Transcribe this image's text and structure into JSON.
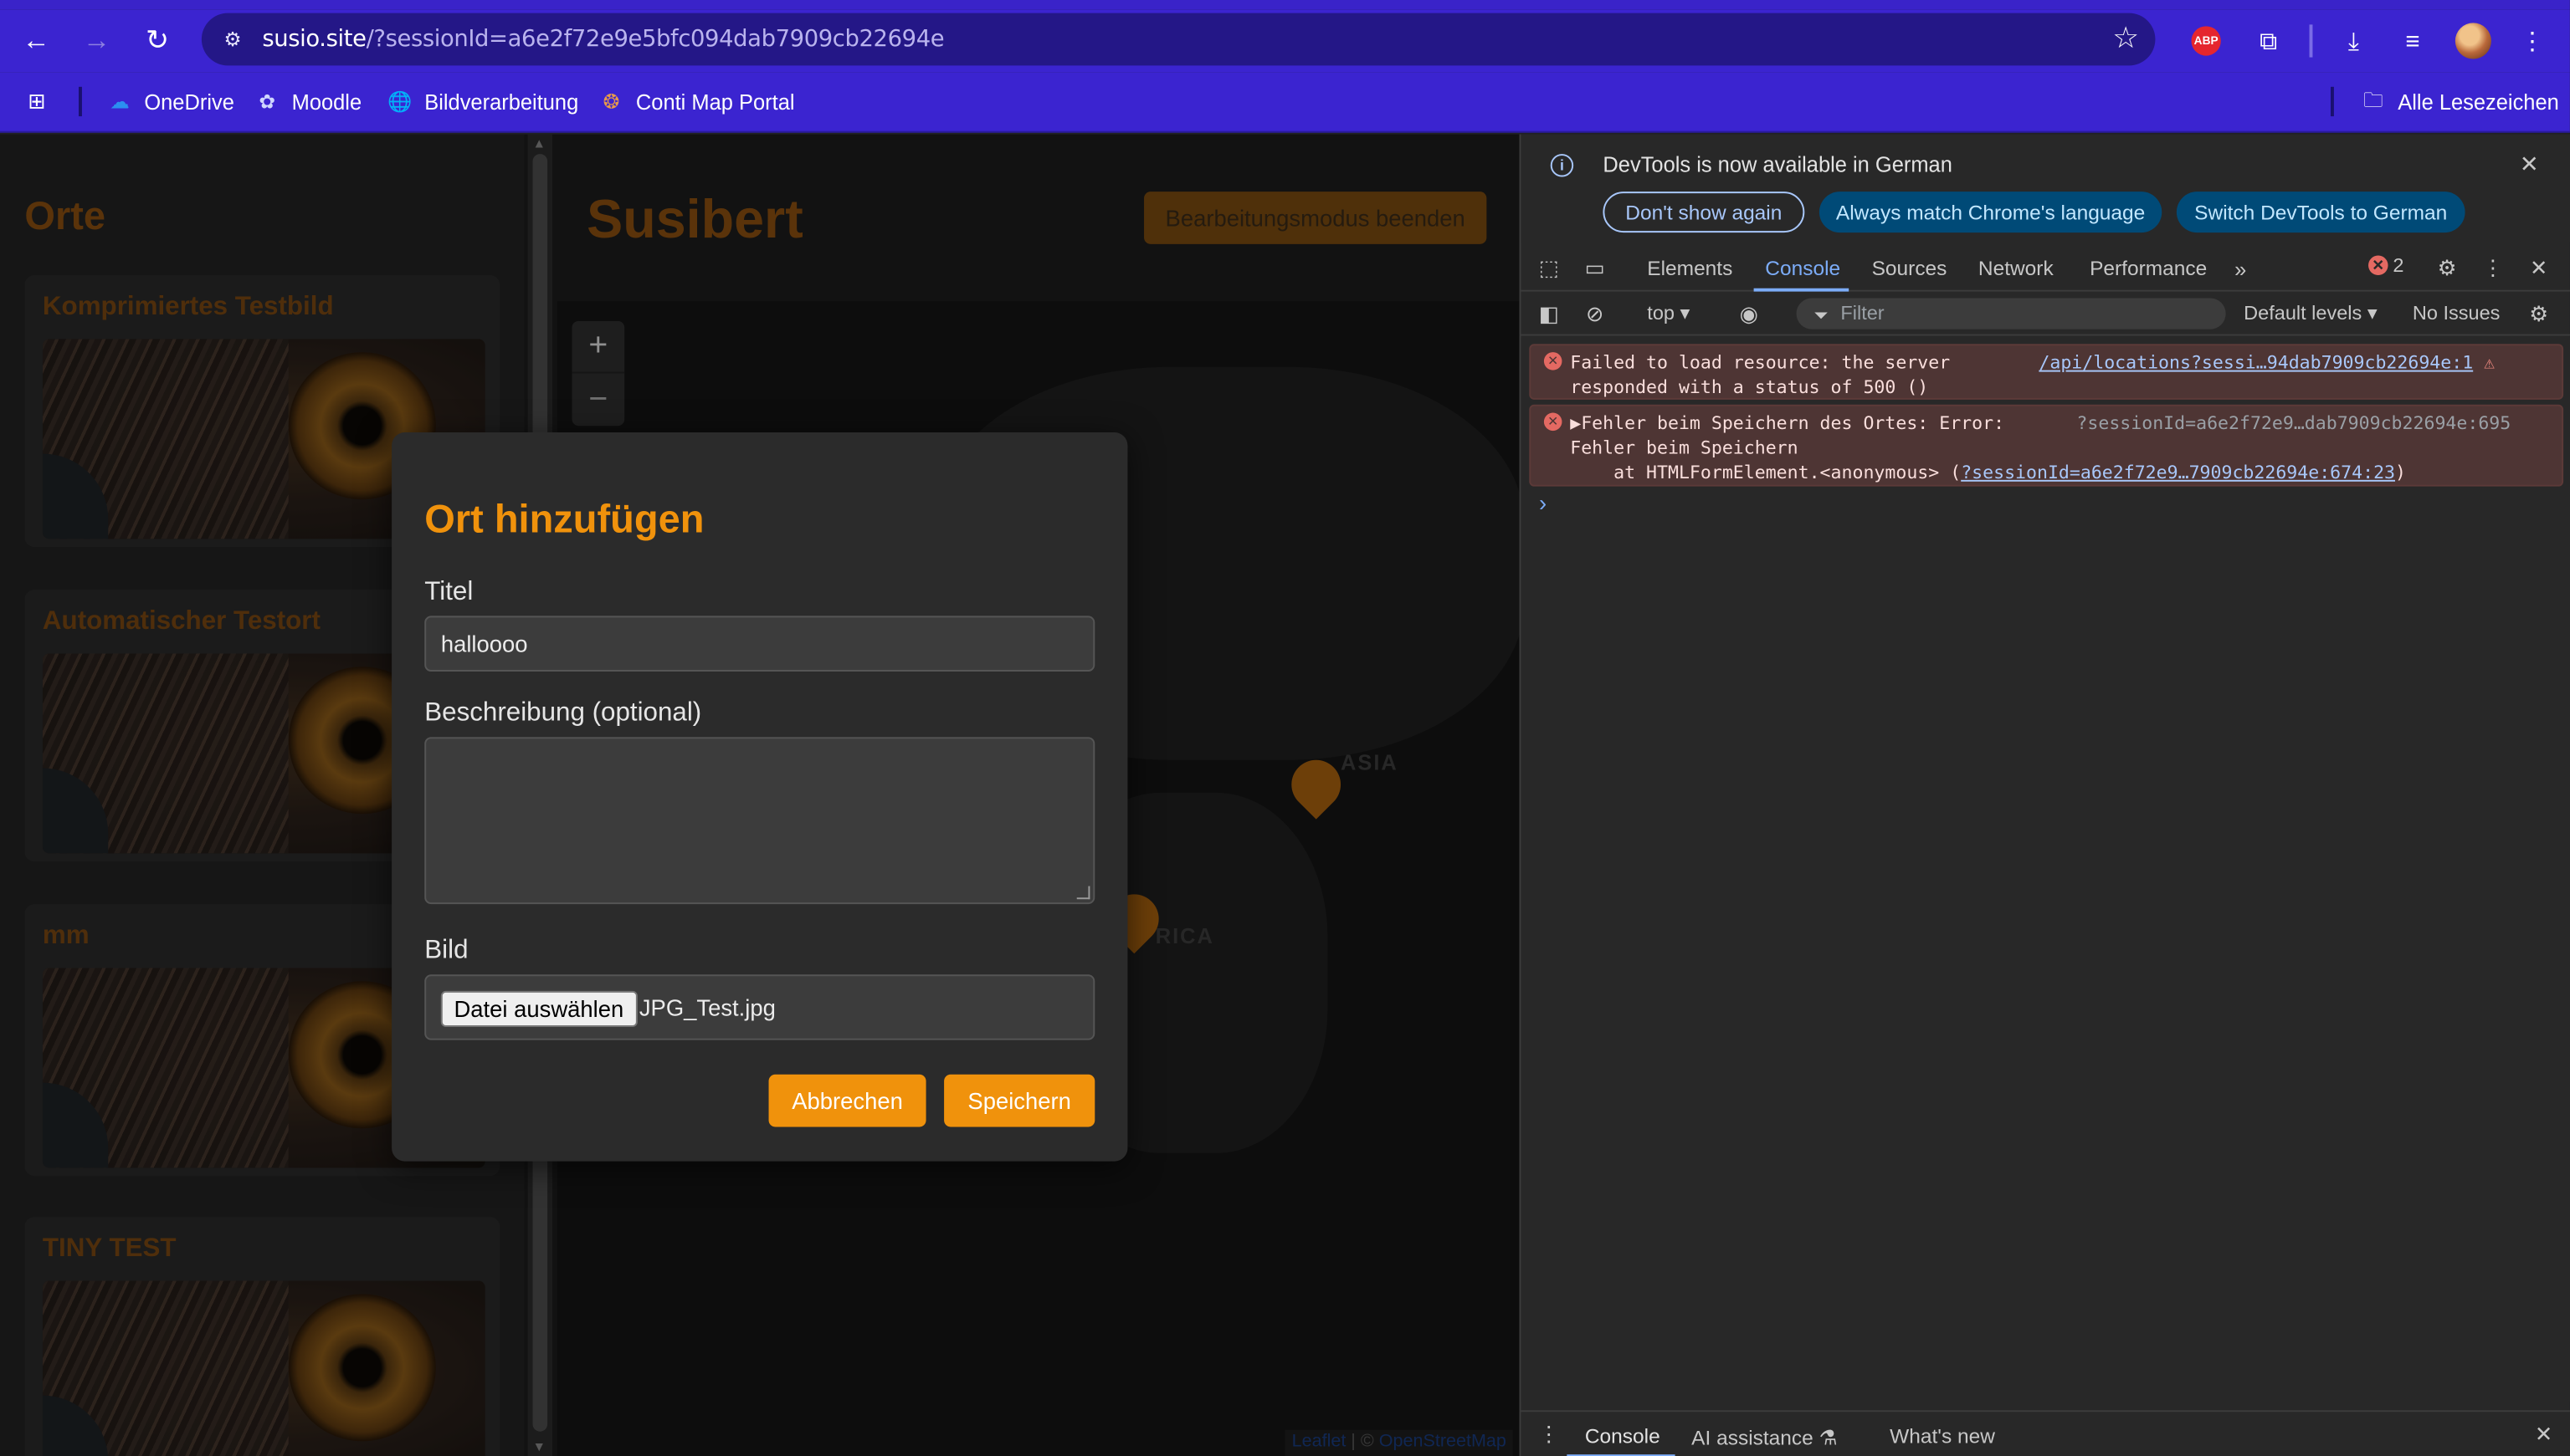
{
  "browser": {
    "url_host": "susio.site",
    "url_path": "/?sessionId=a6e2f72e9e5bfc094dab7909cb22694e",
    "abp_label": "ABP",
    "bookmarks": [
      {
        "label": "OneDrive",
        "icon": "onedrive-icon"
      },
      {
        "label": "Moodle",
        "icon": "moodle-icon"
      },
      {
        "label": "Bildverarbeitung",
        "icon": "globe-icon"
      },
      {
        "label": "Conti Map Portal",
        "icon": "conti-icon"
      }
    ],
    "all_bookmarks_label": "Alle Lesezeichen"
  },
  "sidebar": {
    "title": "Orte",
    "cards": [
      {
        "title": "Komprimiertes Testbild"
      },
      {
        "title": "Automatischer Testort"
      },
      {
        "title": "mm"
      },
      {
        "title": "TINY TEST"
      }
    ]
  },
  "main": {
    "title": "Susibert",
    "edit_button": "Bearbeitungsmodus beenden",
    "map": {
      "zoom_in": "+",
      "zoom_out": "−",
      "labels": [
        "ASIA",
        "RICA"
      ],
      "attribution_leaflet": "Leaflet",
      "attribution_sep": " | © ",
      "attribution_osm": "OpenStreetMap"
    }
  },
  "modal": {
    "title": "Ort hinzufügen",
    "title_label": "Titel",
    "title_value": "halloooo",
    "description_label": "Beschreibung (optional)",
    "description_value": "",
    "image_label": "Bild",
    "file_button": "Datei auswählen",
    "file_name": "JPG_Test.jpg",
    "cancel_button": "Abbrechen",
    "save_button": "Speichern"
  },
  "devtools": {
    "banner_message": "DevTools is now available in German",
    "banner_buttons": [
      "Don't show again",
      "Always match Chrome's language",
      "Switch DevTools to German"
    ],
    "tabs": [
      "Elements",
      "Console",
      "Sources",
      "Network",
      "Performance"
    ],
    "active_tab": "Console",
    "error_count": "2",
    "context": "top",
    "filter_placeholder": "Filter",
    "levels": "Default levels",
    "issues": "No Issues",
    "messages": [
      {
        "text": "Failed to load resource: the server\nresponded with a status of 500 ()",
        "source": "/api/locations?sessi…94dab7909cb22694e:1"
      },
      {
        "text": "▶Fehler beim Speichern des Ortes: Error:\nFehler beim Speichern\n    at HTMLFormElement.<anonymous> (",
        "source": "?sessionId=a6e2f72e9…dab7909cb22694e:695",
        "inline_link": "?sessionId=a6e2f72e9…7909cb22694e:674:23",
        "close_paren": ")"
      }
    ],
    "drawer_tabs": [
      "Console",
      "AI assistance",
      "What's new"
    ]
  },
  "colors": {
    "accent": "#f0920c",
    "browser_frame": "#3b24d0",
    "error_bg": "#4e3534"
  }
}
